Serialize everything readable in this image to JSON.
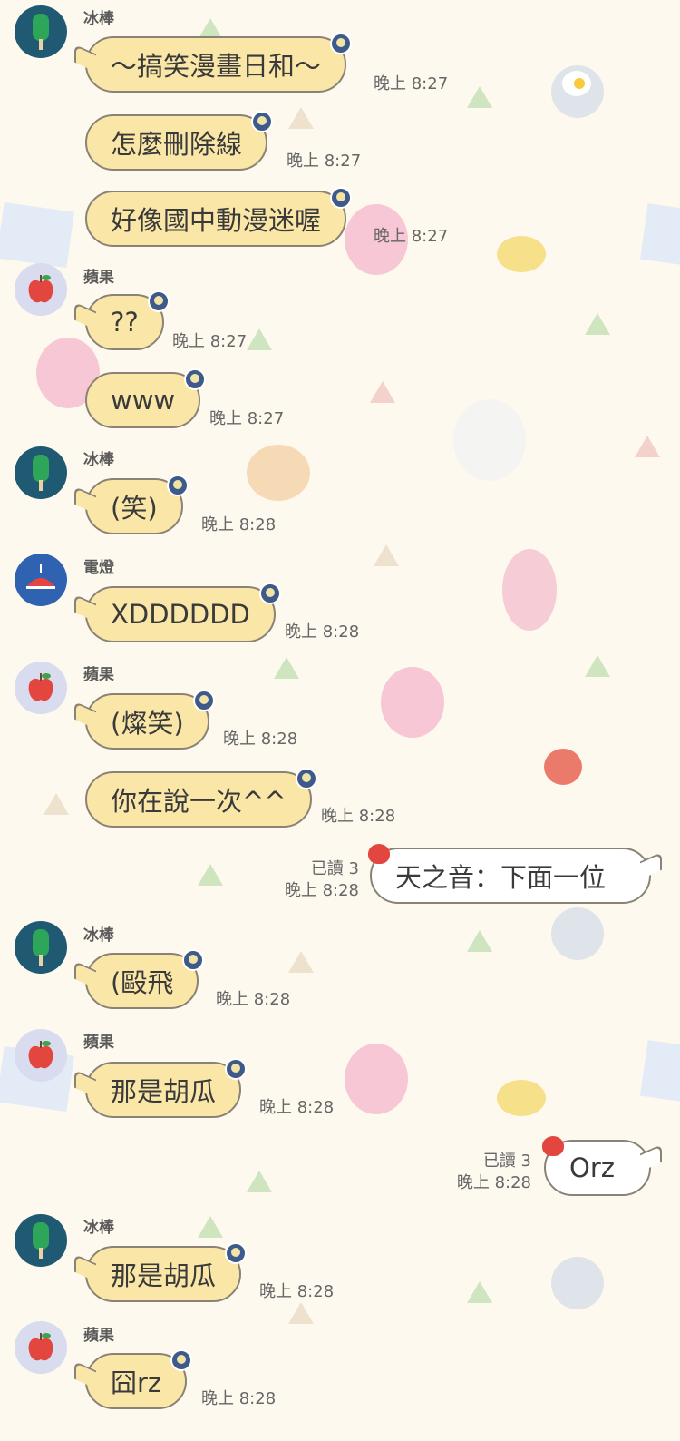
{
  "messages": [
    {
      "sender": "冰棒",
      "text": "～搞笑漫畫日和～",
      "time": "晚上 8:27"
    },
    {
      "text": "怎麼刪除線",
      "time": "晚上 8:27"
    },
    {
      "text": "好像國中動漫迷喔",
      "time": "晚上 8:27"
    },
    {
      "sender": "蘋果",
      "text": "??",
      "time": "晚上 8:27"
    },
    {
      "text": "www",
      "time": "晚上 8:27"
    },
    {
      "sender": "冰棒",
      "text": "(笑)",
      "time": "晚上 8:28"
    },
    {
      "sender": "電燈",
      "text": "XDDDDDD",
      "time": "晚上 8:28"
    },
    {
      "sender": "蘋果",
      "text": "(燦笑)",
      "time": "晚上 8:28"
    },
    {
      "text": "你在說一次^^",
      "time": "晚上 8:28"
    },
    {
      "outgoing": true,
      "read": "已讀 3",
      "text": "天之音：下面一位",
      "time": "晚上 8:28"
    },
    {
      "sender": "冰棒",
      "text": "(毆飛",
      "time": "晚上 8:28"
    },
    {
      "sender": "蘋果",
      "text": "那是胡瓜",
      "time": "晚上 8:28"
    },
    {
      "outgoing": true,
      "read": "已讀 3",
      "text": "Orz",
      "time": "晚上 8:28"
    },
    {
      "sender": "冰棒",
      "text": "那是胡瓜",
      "time": "晚上 8:28"
    },
    {
      "sender": "蘋果",
      "text": "囧rz",
      "time": "晚上 8:28"
    }
  ],
  "icons": {
    "popsicle_avatar": "popsicle-icon",
    "apple_avatar": "apple-icon",
    "lamp_avatar": "lamp-icon",
    "bubble_badge": "egg-pan-icon"
  },
  "colors": {
    "background": "#fdf9ef",
    "incoming_bubble": "#fae7a8",
    "outgoing_bubble": "#ffffff",
    "bubble_border": "#8a8275"
  }
}
